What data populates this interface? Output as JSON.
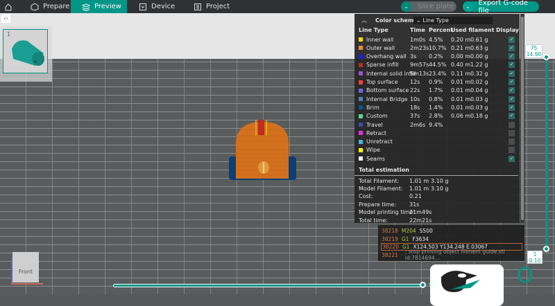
{
  "topbar": {
    "tabs": [
      {
        "label": "Prepare"
      },
      {
        "label": "Preview"
      },
      {
        "label": "Device"
      },
      {
        "label": "Project"
      }
    ],
    "slice_label": "Slice plate",
    "export_label": "Export G-code file"
  },
  "plate": {
    "number": "1"
  },
  "legend": {
    "color_scheme_label": "Color scheme",
    "color_scheme_value": "Line Type",
    "headers": {
      "type": "Line Type",
      "time": "Time",
      "percent": "Percent",
      "used": "Used filament",
      "display": "Display"
    },
    "rows": [
      {
        "name": "Inner wall",
        "color": "#f5d90a",
        "time": "1m0s",
        "percent": "4.5%",
        "m": "0.20 m",
        "g": "0.61 g",
        "on": true
      },
      {
        "name": "Outer wall",
        "color": "#ef8a33",
        "time": "2m23s",
        "percent": "10.7%",
        "m": "0.21 m",
        "g": "0.63 g",
        "on": true
      },
      {
        "name": "Overhang wall",
        "color": "#1a1aee",
        "time": "3s",
        "percent": "0.2%",
        "m": "0.00 m",
        "g": "0.00 g",
        "on": true
      },
      {
        "name": "Sparse infill",
        "color": "#b03029",
        "time": "9m57s",
        "percent": "44.5%",
        "m": "0.40 m",
        "g": "1.22 g",
        "on": true
      },
      {
        "name": "Internal solid infill",
        "color": "#9654cc",
        "time": "5m13s",
        "percent": "23.4%",
        "m": "0.11 m",
        "g": "0.32 g",
        "on": true
      },
      {
        "name": "Top surface",
        "color": "#f04040",
        "time": "12s",
        "percent": "0.9%",
        "m": "0.01 m",
        "g": "0.02 g",
        "on": true
      },
      {
        "name": "Bottom surface",
        "color": "#7566e0",
        "time": "22s",
        "percent": "1.7%",
        "m": "0.01 m",
        "g": "0.04 g",
        "on": true
      },
      {
        "name": "Internal Bridge",
        "color": "#4d80ba",
        "time": "10s",
        "percent": "0.8%",
        "m": "0.01 m",
        "g": "0.03 g",
        "on": true
      },
      {
        "name": "Brim",
        "color": "#00598c",
        "time": "18s",
        "percent": "1.4%",
        "m": "0.01 m",
        "g": "0.03 g",
        "on": true
      },
      {
        "name": "Custom",
        "color": "#5ed194",
        "time": "37s",
        "percent": "2.8%",
        "m": "0.06 m",
        "g": "0.18 g",
        "on": true
      },
      {
        "name": "Travel",
        "color": "#3350a8",
        "time": "2m6s",
        "percent": "9.4%",
        "m": "",
        "g": "",
        "on": false
      },
      {
        "name": "Retract",
        "color": "#e22ee2",
        "time": "",
        "percent": "",
        "m": "",
        "g": "",
        "on": false
      },
      {
        "name": "Unretract",
        "color": "#3fb8d8",
        "time": "",
        "percent": "",
        "m": "",
        "g": "",
        "on": false
      },
      {
        "name": "Wipe",
        "color": "#ffff00",
        "time": "",
        "percent": "",
        "m": "",
        "g": "",
        "on": false
      },
      {
        "name": "Seams",
        "color": "#eeeeee",
        "time": "",
        "percent": "",
        "m": "",
        "g": "",
        "on": true
      }
    ],
    "total_title": "Total estimation",
    "totals": [
      {
        "label": "Total Filament:",
        "v1": "1.01 m",
        "v2": "3.10 g"
      },
      {
        "label": "Model Filament:",
        "v1": "1.01 m",
        "v2": "3.10 g"
      },
      {
        "label": "Cost:",
        "v1": "0.21",
        "v2": ""
      },
      {
        "label": "Prepare time:",
        "v1": "31s",
        "v2": ""
      },
      {
        "label": "Model printing time:",
        "v1": "21m49s",
        "v2": ""
      },
      {
        "label": "Total time:",
        "v1": "22m21s",
        "v2": ""
      }
    ]
  },
  "gcode": [
    {
      "line": "38218",
      "cmd": "M204",
      "args": "S500"
    },
    {
      "line": "38219",
      "cmd": "G1",
      "args": "F3634"
    },
    {
      "line": "38220",
      "cmd": "G1",
      "args": "X124.503 Y134.248 E.03067"
    },
    {
      "line": "38221",
      "cmd": "",
      "args": "; stop printing object filiment guide.stl id:7814694..."
    }
  ],
  "layer_slider": {
    "top_layer": "75",
    "top_height": "14.90",
    "bottom_layer": "1",
    "bottom_height": "0.10"
  },
  "move_slider": {
    "value": "91"
  },
  "view_cube": {
    "label": "Front"
  }
}
